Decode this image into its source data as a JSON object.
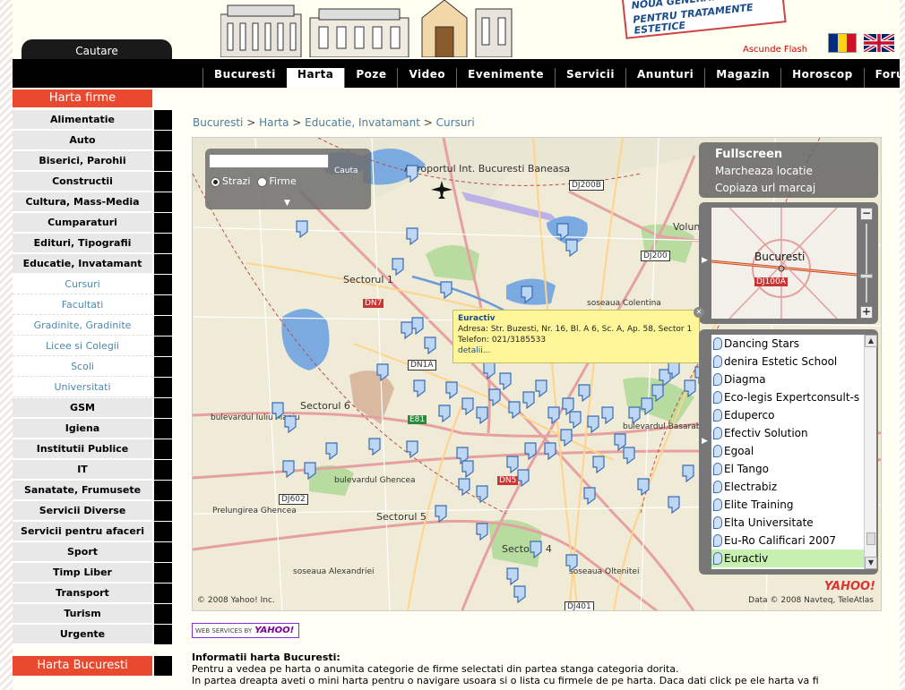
{
  "header": {
    "search_tab": "Cautare",
    "billboard_line1": "NOUA GENERATIE DE",
    "billboard_line2": "PENTRU TRATAMENTE ESTETICE",
    "flash_link": "Ascunde Flash"
  },
  "nav": {
    "items": [
      "Bucuresti",
      "Harta",
      "Poze",
      "Video",
      "Evenimente",
      "Servicii",
      "Anunturi",
      "Magazin",
      "Horoscop",
      "Forum"
    ],
    "active": "Harta"
  },
  "sidebar": {
    "heading": "Harta firme",
    "items": [
      {
        "label": "Alimentatie",
        "sub": false
      },
      {
        "label": "Auto",
        "sub": false
      },
      {
        "label": "Biserici, Parohii",
        "sub": false
      },
      {
        "label": "Constructii",
        "sub": false
      },
      {
        "label": "Cultura, Mass-Media",
        "sub": false
      },
      {
        "label": "Cumparaturi",
        "sub": false
      },
      {
        "label": "Edituri, Tipografii",
        "sub": false
      },
      {
        "label": "Educatie, Invatamant",
        "sub": false
      },
      {
        "label": "Cursuri",
        "sub": true
      },
      {
        "label": "Facultati",
        "sub": true
      },
      {
        "label": "Gradinite, Gradinite",
        "sub": true
      },
      {
        "label": "Licee si Colegii",
        "sub": true
      },
      {
        "label": "Scoli",
        "sub": true
      },
      {
        "label": "Universitati",
        "sub": true
      },
      {
        "label": "GSM",
        "sub": false
      },
      {
        "label": "Igiena",
        "sub": false
      },
      {
        "label": "Institutii Publice",
        "sub": false
      },
      {
        "label": "IT",
        "sub": false
      },
      {
        "label": "Sanatate, Frumusete",
        "sub": false
      },
      {
        "label": "Servicii Diverse",
        "sub": false
      },
      {
        "label": "Servicii pentru afaceri",
        "sub": false
      },
      {
        "label": "Sport",
        "sub": false
      },
      {
        "label": "Timp Liber",
        "sub": false
      },
      {
        "label": "Transport",
        "sub": false
      },
      {
        "label": "Turism",
        "sub": false
      },
      {
        "label": "Urgente",
        "sub": false
      }
    ],
    "heading2": "Harta Bucuresti"
  },
  "breadcrumb": [
    "Bucuresti",
    "Harta",
    "Educatie, Invatamant",
    "Cursuri"
  ],
  "map": {
    "search_placeholder": "",
    "search_button": "Cauta",
    "radio_strazi": "Strazi",
    "radio_firme": "Firme",
    "panel_title": "Fullscreen",
    "panel_link1": "Marcheaza locatie",
    "panel_link2": "Copiaza url marcaj",
    "minimap_label": "Bucuresti",
    "minimap_road": "DJ100A",
    "labels": {
      "aeroport": "Aeroportul Int. Bucuresti Baneasa",
      "sector1": "Sectorul 1",
      "sector6": "Sectorul 6",
      "sector5": "Sectorul 5",
      "sector4": "Sectorul 4",
      "voluntari": "Voluntari",
      "ghencea": "bulevardul Ghencea",
      "prelungirea": "Prelungirea Ghencea",
      "iuliu": "bulevardul Iuliu Maniu",
      "alexandria": "soseaua Alexandriei",
      "colentina": "soseaua Colentina",
      "basarabia": "bulevardul Basarabia",
      "oltenitei": "soseaua Oltenitei",
      "dj200b": "DJ200B",
      "dj200": "DJ200",
      "dj401": "DJ401",
      "dj602": "DJ602",
      "dn1a": "DN1A",
      "dn7": "DN7",
      "e81": "E81",
      "dn5": "DN5"
    },
    "popup": {
      "title": "Euractiv",
      "address": "Adresa: Str. Buzesti, Nr. 16, Bl. A 6, Sc. A, Ap. 58, Sector 1",
      "phone": "Telefon: 021/3185533",
      "details": "detalii..."
    },
    "list": [
      "Dancing Stars",
      "denira Estetic School",
      "Diagma",
      "Eco-legis Expertconsult-s",
      "Eduperco",
      "Efectiv Solution",
      "Egoal",
      "El Tango",
      "Electrabiz",
      "Elite Training",
      "Elta Universitate",
      "Eu-Ro Calificari 2007",
      "Euractiv"
    ],
    "list_selected": "Euractiv",
    "copyright_left": "© 2008 Yahoo! Inc.",
    "copyright_right": "Data © 2008 Navteq, TeleAtlas",
    "yahoo_logo": "YAHOO!"
  },
  "badge": {
    "prefix": "WEB SERVICES BY",
    "brand": "YAHOO!"
  },
  "info": {
    "title": "Informatii harta Bucuresti:",
    "line1": "Pentru a vedea pe harta o anumita categorie de firme selectati din partea stanga categoria dorita.",
    "line2": "In partea dreapta aveti o mini harta pentru o navigare usoara si o lista cu firmele de pe harta. Daca dati click pe ele harta va fi"
  },
  "colors": {
    "accent": "#e8492f",
    "link": "#4c7c9a",
    "popup": "#fff69a",
    "selected": "#c7f0b0"
  }
}
